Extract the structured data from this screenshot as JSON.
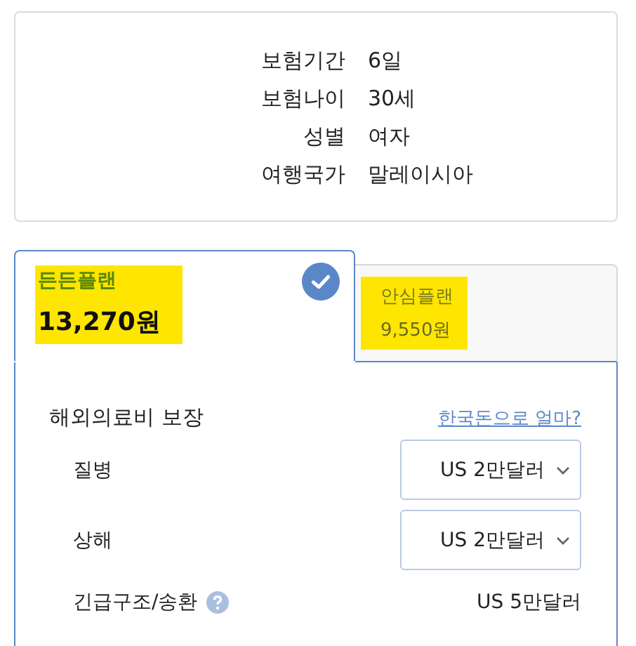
{
  "summary": [
    {
      "label": "보험기간",
      "value": "6일"
    },
    {
      "label": "보험나이",
      "value": "30세"
    },
    {
      "label": "성별",
      "value": "여자"
    },
    {
      "label": "여행국가",
      "value": "말레이시아"
    }
  ],
  "plans": [
    {
      "name": "든든플랜",
      "price": "13,270원",
      "selected": true,
      "highlighted": true
    },
    {
      "name": "안심플랜",
      "price": "9,550원",
      "selected": false,
      "highlighted": true
    }
  ],
  "coverage": {
    "title": "해외의료비 보장",
    "link": "한국돈으로 얼마?",
    "rows": [
      {
        "kind": "select",
        "label": "질병",
        "value": "US 2만달러"
      },
      {
        "kind": "select",
        "label": "상해",
        "value": "US 2만달러"
      },
      {
        "kind": "text",
        "label": "긴급구조/송환",
        "help": true,
        "value": "US 5만달러"
      }
    ]
  }
}
